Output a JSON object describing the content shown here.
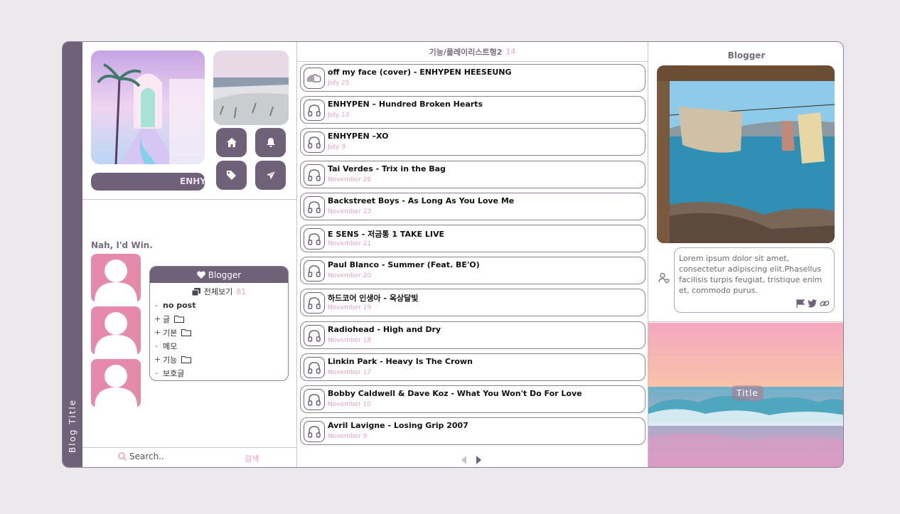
{
  "blog": {
    "vertical_title": "Blog Title"
  },
  "left": {
    "marquee_text": "ENHYPEN",
    "caption": "Nah, I'd Win.",
    "category_box": {
      "header": "Blogger",
      "total_label": "전체보기",
      "total_count": "81",
      "items": [
        {
          "mark": "-",
          "label": "no post",
          "folder": false,
          "bold": true
        },
        {
          "mark": "+",
          "label": "글",
          "folder": true,
          "bold": false
        },
        {
          "mark": "+",
          "label": "기본",
          "folder": true,
          "bold": false
        },
        {
          "mark": "-",
          "label": "메모",
          "folder": false,
          "bold": false
        },
        {
          "mark": "+",
          "label": "기능",
          "folder": true,
          "bold": false
        },
        {
          "mark": "-",
          "label": "보호글",
          "folder": false,
          "bold": false
        }
      ]
    },
    "search": {
      "placeholder": "Search..",
      "button": "검색"
    },
    "icons": [
      "home-icon",
      "bell-icon",
      "tag-icon",
      "paper-plane-icon"
    ]
  },
  "playlist": {
    "title": "기능/플레이리스트형2",
    "count": "14",
    "tracks": [
      {
        "title": "off my face (cover) - ENHYPEN HEESEUNG",
        "date": "July 25",
        "icon": "soundcloud-icon"
      },
      {
        "title": "ENHYPEN – Hundred Broken Hearts",
        "date": "July 13",
        "icon": "headphones-icon"
      },
      {
        "title": "ENHYPEN –XO",
        "date": "July 9",
        "icon": "headphones-icon"
      },
      {
        "title": "Tai Verdes - Trix in the Bag",
        "date": "November 26",
        "icon": "headphones-icon"
      },
      {
        "title": "Backstreet Boys - As Long As You Love Me",
        "date": "November 23",
        "icon": "headphones-icon"
      },
      {
        "title": "E SENS - 저금통 1 TAKE LIVE",
        "date": "November 21",
        "icon": "headphones-icon"
      },
      {
        "title": "Paul Blanco - Summer (Feat. BE'O)",
        "date": "November 20",
        "icon": "headphones-icon"
      },
      {
        "title": "하드코어 인생아 - 옥상달빛",
        "date": "November 19",
        "icon": "headphones-icon"
      },
      {
        "title": "Radiohead - High and Dry",
        "date": "November 18",
        "icon": "headphones-icon"
      },
      {
        "title": "Linkin Park - Heavy Is The Crown",
        "date": "November 17",
        "icon": "headphones-icon"
      },
      {
        "title": "Bobby Caldwell & Dave Koz - What You Won't Do For Love",
        "date": "November 10",
        "icon": "headphones-icon"
      },
      {
        "title": "Avril Lavigne - Losing Grip 2007",
        "date": "November 9",
        "icon": "headphones-icon"
      }
    ]
  },
  "right": {
    "title": "Blogger",
    "bio": "Lorem ipsum dolor sit amet, consectetur adipiscing elit.Phasellus facilisis turpis feugiat, tristique enim et, commodo purus.",
    "sea_title": "Title"
  },
  "colors": {
    "accent": "#6e6178",
    "pink": "#e58aaa",
    "pink_text": "#f1a1bf",
    "border": "#8f8297"
  }
}
